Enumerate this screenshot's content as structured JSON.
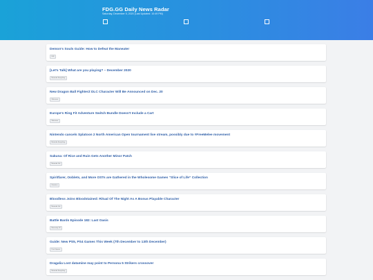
{
  "header": {
    "title": "FDG.GG Daily News Radar",
    "subtitle": "Saturday, December 5, 2020 (Last Updated: 10:49 PM)"
  },
  "articles": [
    {
      "title": "Demon's Souls Guide: How to Defeat the Maneater",
      "source": "IGN"
    },
    {
      "title": "[Let's Talk] What are you playing? – December 2020",
      "source": "Nintendo Everything"
    },
    {
      "title": "New Dragon Ball FighterZ DLC Character Will Be Announced on Dec. 20",
      "source": "Siliconera"
    },
    {
      "title": "Europe's Ring Fit Adventure Switch Bundle Doesn't Include a Cart",
      "source": "Siliconera"
    },
    {
      "title": "Nintendo cancels Splatoon 2 North American Open tournament live stream, possibly due to #FreeMelee movement",
      "source": "Nintendo Everything"
    },
    {
      "title": "Sakuna: Of Rice and Ruin Gets Another Minor Patch",
      "source": "Nintendo Life"
    },
    {
      "title": "Spiritfarer, Ooblets, and More OSTs are Gathered in the Wholesome Games “Slice of Life” Collection",
      "source": "Gematsu"
    },
    {
      "title": "Bloodless Joins Bloodstained: Ritual Of The Night As A Bonus Playable Character",
      "source": "Nintendo Life"
    },
    {
      "title": "Battle Bards Episode 182: Last Oasis",
      "source": "Massively OP"
    },
    {
      "title": "Guide: New PS5, PS4 Games This Week (7th December to 13th December)",
      "source": "Push Square"
    },
    {
      "title": "Dragalia Lost datamine may point to Persona 5 Strikers crossover",
      "source": "Nintendo Everything"
    }
  ]
}
